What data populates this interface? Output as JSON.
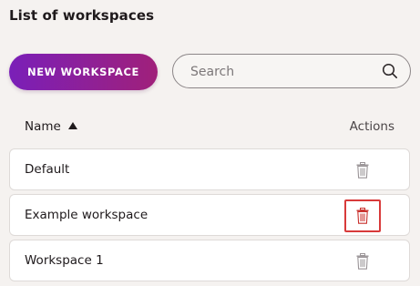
{
  "page": {
    "title": "List of workspaces"
  },
  "toolbar": {
    "new_label": "NEW WORKSPACE",
    "search_placeholder": "Search",
    "search_value": ""
  },
  "table": {
    "columns": {
      "name": "Name",
      "actions": "Actions"
    },
    "sort": "ascending",
    "rows": [
      {
        "name": "Default"
      },
      {
        "name": "Example workspace"
      },
      {
        "name": "Workspace 1"
      }
    ]
  },
  "icons": {
    "search": "search-icon",
    "sort": "sort-ascending-icon",
    "delete": "trash-icon"
  },
  "colors": {
    "button_gradient_start": "#7a1fb8",
    "button_gradient_end": "#a0207a",
    "focus_outline": "#d83a3a",
    "trash_default": "#9a9497",
    "trash_highlight": "#c9302c"
  }
}
